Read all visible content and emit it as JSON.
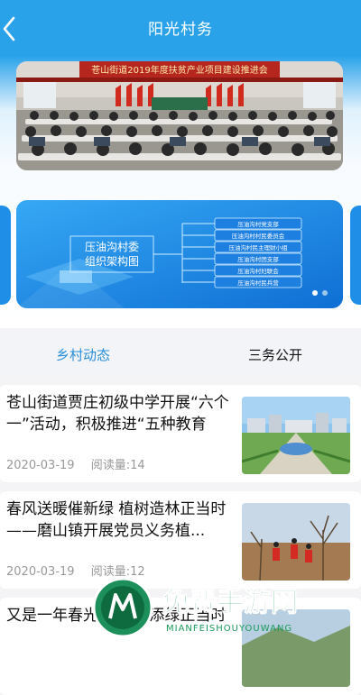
{
  "header": {
    "title": "阳光村务"
  },
  "banner": {
    "photo": {
      "caption": "苍山街道2019年度扶贫产业项目建设推进会"
    },
    "org_chart": {
      "title_line1": "压油沟村委",
      "title_line2": "组织架构图",
      "branches": [
        "压油沟村党支部",
        "压油沟村村民委员会",
        "压油沟村民主理财小组",
        "压油沟村团支部",
        "压油沟村妇联会",
        "压油沟村民兵营"
      ]
    }
  },
  "tabs": [
    {
      "label": "乡村动态",
      "active": true
    },
    {
      "label": "三务公开",
      "active": false
    }
  ],
  "news": [
    {
      "title": "苍山街道贾庄初级中学开展“六个一”活动，积极推进“五种教育",
      "date": "2020-03-19",
      "reads": "阅读量:14",
      "thumb_icon": "city-square-photo"
    },
    {
      "title": "春风送暖催新绿 植树造林正当时——磨山镇开展党员义务植...",
      "date": "2020-03-19",
      "reads": "阅读量:12",
      "thumb_icon": "tree-planting-photo"
    },
    {
      "title": "又是一年春光好 植树添绿正当时",
      "date": "",
      "reads": "",
      "thumb_icon": "landscape-photo"
    }
  ],
  "watermark": {
    "text": "免费手游网",
    "subtext": "MIANFEISHOUYOUWANG"
  },
  "colors": {
    "header": "#2aa2ea",
    "tab_active": "#2a8fd8",
    "card_blue": "#1f8ee6"
  }
}
